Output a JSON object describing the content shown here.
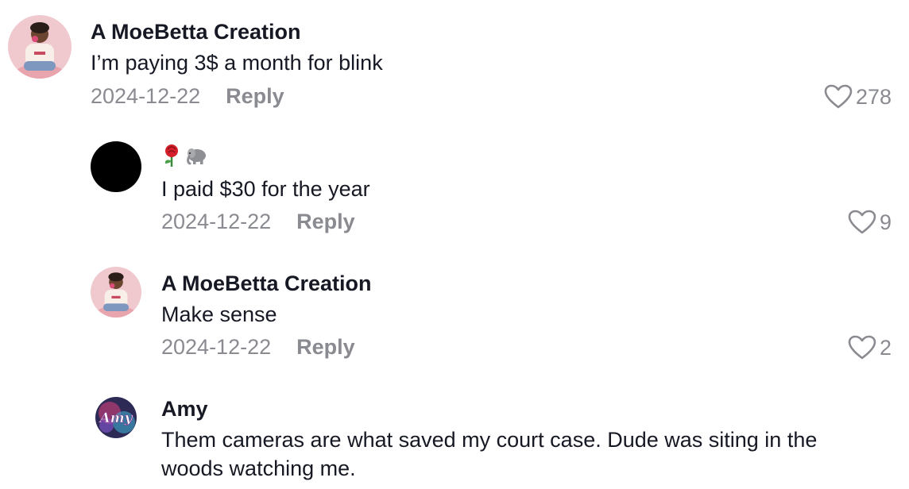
{
  "comments": [
    {
      "username": "A MoeBetta Creation",
      "text": "I’m paying 3$ a month for blink",
      "date": "2024-12-22",
      "reply_label": "Reply",
      "likes": "278"
    },
    {
      "username": "",
      "name_emojis": [
        "rose-icon",
        "elephant-icon"
      ],
      "text": "I paid $30 for the year",
      "date": "2024-12-22",
      "reply_label": "Reply",
      "likes": "9"
    },
    {
      "username": "A MoeBetta Creation",
      "text": "Make sense",
      "date": "2024-12-22",
      "reply_label": "Reply",
      "likes": "2"
    },
    {
      "username": "Amy",
      "text": "Them cameras are what saved my court case. Dude was siting in the woods watching me.",
      "avatar_text": "Amy"
    }
  ],
  "colors": {
    "text_primary": "#161823",
    "text_secondary": "#8a8b91",
    "background": "#ffffff"
  }
}
